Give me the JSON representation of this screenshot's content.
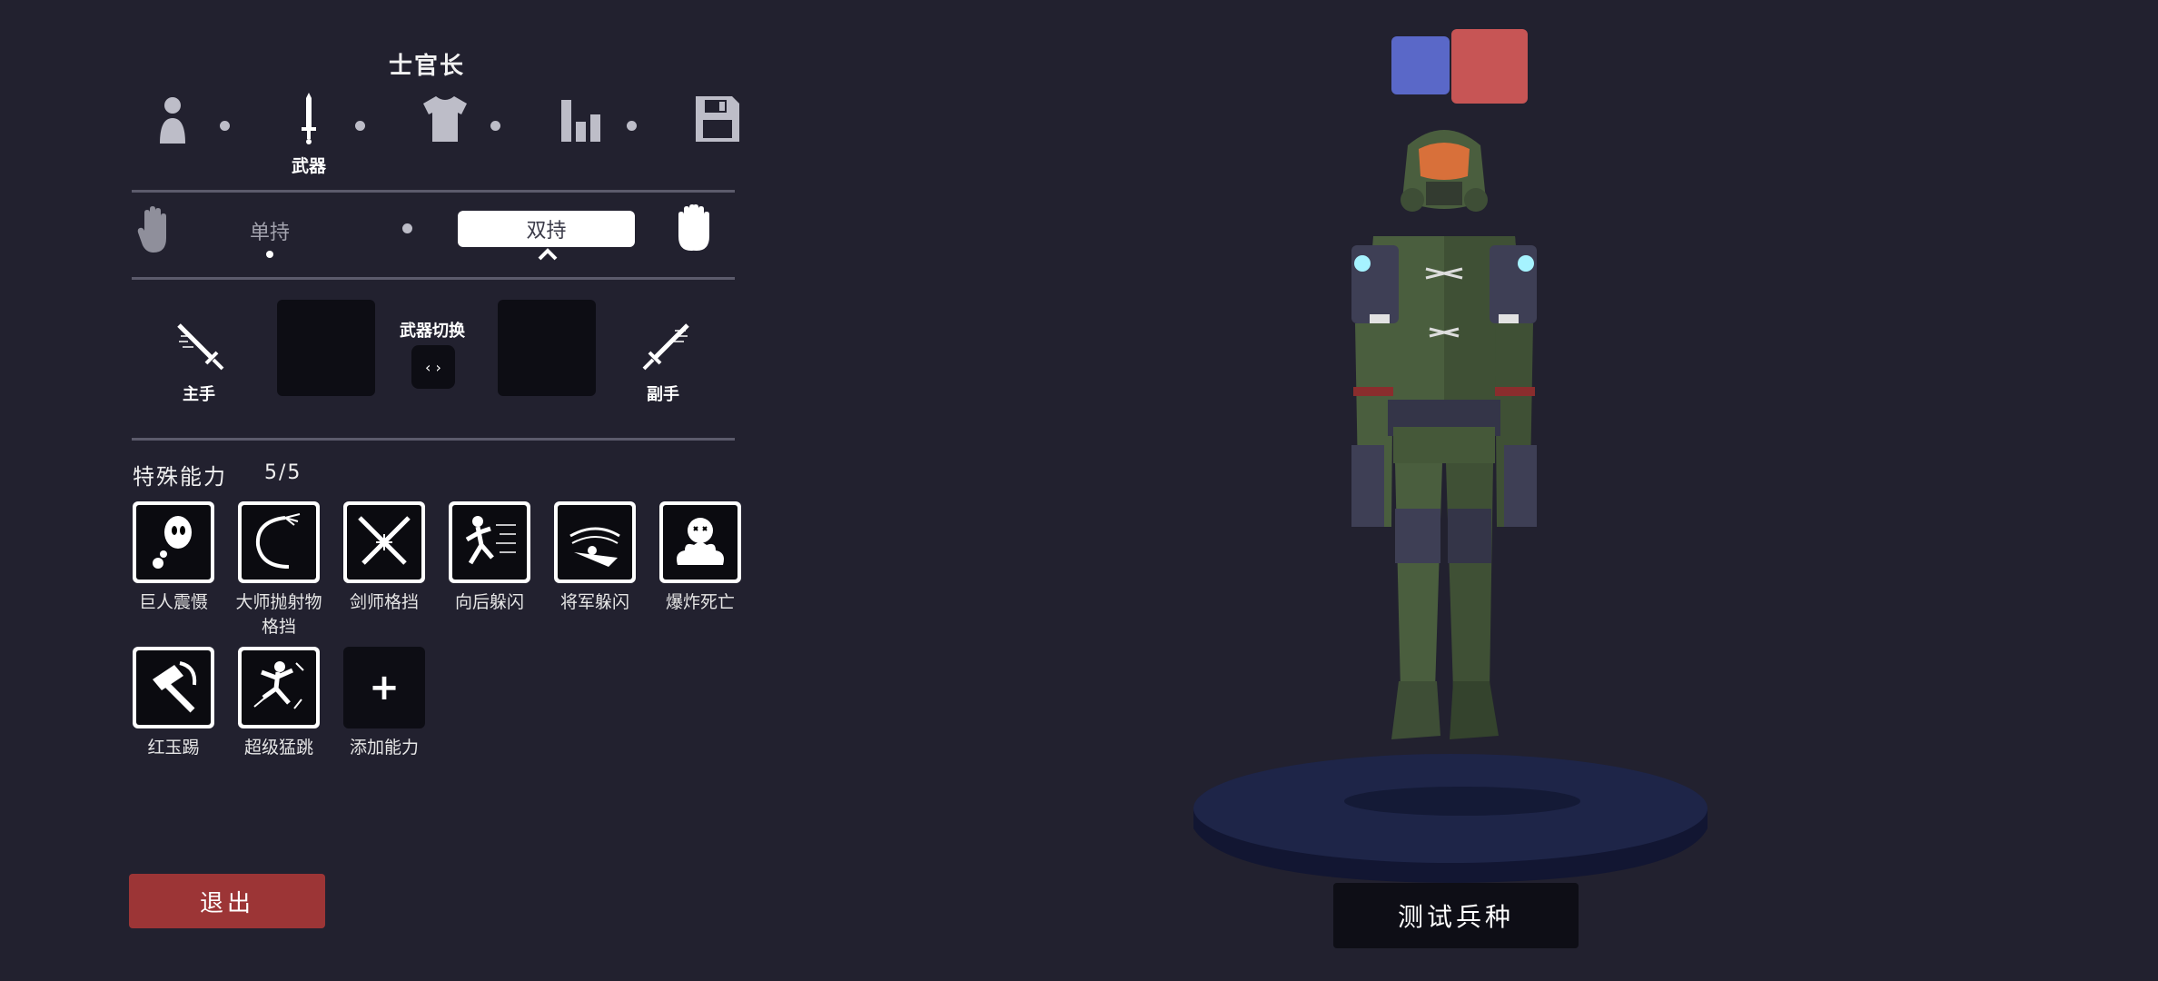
{
  "unit": {
    "title": "士官长"
  },
  "steps": [
    {
      "icon": "person-icon",
      "label": ""
    },
    {
      "icon": "sword-icon",
      "label": "武器"
    },
    {
      "icon": "shirt-icon",
      "label": ""
    },
    {
      "icon": "stats-icon",
      "label": ""
    },
    {
      "icon": "save-icon",
      "label": ""
    }
  ],
  "handedness": {
    "single_label": "单持",
    "dual_label": "双持",
    "selected": "dual"
  },
  "weapons": {
    "main_hand_label": "主手",
    "off_hand_label": "副手",
    "switch_label": "武器切换",
    "switch_button": "‹ ›"
  },
  "abilities": {
    "header": "特殊能力",
    "count": "5/5",
    "items": [
      {
        "label": "巨人震慑",
        "icon": "ghost-icon"
      },
      {
        "label": "大师抛射物格挡",
        "icon": "deflect-arc-icon"
      },
      {
        "label": "剑师格挡",
        "icon": "crossed-swords-icon"
      },
      {
        "label": "向后躲闪",
        "icon": "backflip-icon"
      },
      {
        "label": "将军躲闪",
        "icon": "dodge-swirl-icon"
      },
      {
        "label": "爆炸死亡",
        "icon": "explosion-skull-icon"
      },
      {
        "label": "红玉踢",
        "icon": "hammer-kick-icon"
      },
      {
        "label": "超级猛跳",
        "icon": "super-jump-icon"
      }
    ],
    "add_label": "添加能力",
    "add_symbol": "+"
  },
  "buttons": {
    "exit": "退出",
    "test_unit": "测试兵种"
  },
  "colors": {
    "background": "#22212f",
    "team_blue": "#5a68c8",
    "team_red": "#c75555",
    "exit": "#9c3536",
    "armor": "#4a5e3e",
    "visor": "#d8703a"
  }
}
